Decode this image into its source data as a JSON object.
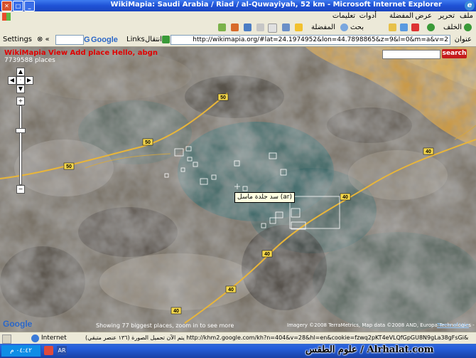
{
  "window": {
    "title": "WikiMapia: Saudi Arabia / Riad / al-Quwayiyah, 52 km - Microsoft Internet Explorer"
  },
  "menu": [
    "ملف",
    "تحرير",
    "عرض",
    "المفضلة",
    "أدوات",
    "تعليمات"
  ],
  "toolbar": {
    "back": "الخلف",
    "search": "بحث",
    "favorites": "المفضلة"
  },
  "addressbar": {
    "label": "عنوان",
    "url": "http://wikimapia.org/#lat=24.1974952&lon=44.7898865&z=9&l=0&m=a&v=2",
    "go": "انتقال",
    "links": "Links",
    "settings": "Settings",
    "google": "Google"
  },
  "wikimapia": {
    "nav": "WikiMapia   View   Add place   Hello, abgn",
    "places_count": "7739588 places",
    "search_button": "search"
  },
  "map": {
    "tooltip": "سد جلدة ماسل (ar)",
    "showing": "Showing 77 biggest places, zoom in to see more",
    "imagery": "Imagery ©2008 TerraMetrics, Map data ©2008 AND, Europa Technologies -",
    "terms": "Terms of Use",
    "google": "Google",
    "route_labels": [
      "50",
      "50",
      "50",
      "40",
      "40",
      "40",
      "40",
      "40"
    ]
  },
  "status": {
    "text": "(١٣٦ عنصر متبقي) يتم الآن تحميل الصورة http://khm2.google.com/kh?n=404&v=28&hl=en&cookie=fzwq2pKT4eVLQfGpGU8N9gLa38gFsGi&...",
    "zone": "Internet"
  },
  "taskbar": {
    "clock": "٠٤:٤٢ م",
    "watermark": "علوم الطقس / Alrhalat.com",
    "lang": "AR"
  },
  "colors": {
    "titlebar": "#2456d8",
    "search_button": "#c61b1b",
    "road": "#e8b53a",
    "header_link": "#e00000"
  }
}
